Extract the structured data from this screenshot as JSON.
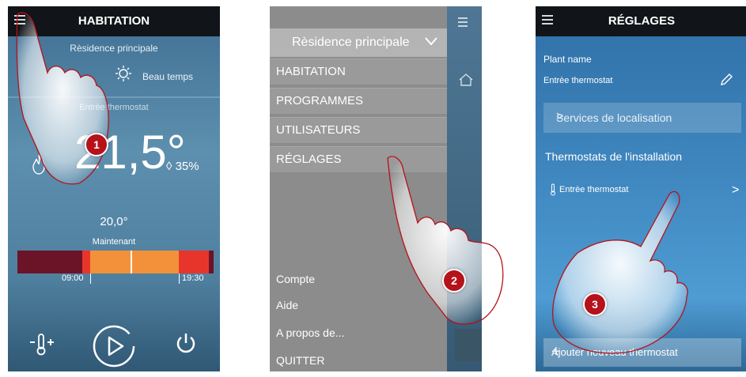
{
  "screen1": {
    "title": "HABITATION",
    "residence": "Rèsidence principale",
    "weather": "Beau temps",
    "thermostat_name": "Entrèe thermostat",
    "temperature": "21,5°",
    "humidity": "35%",
    "setpoint": "20,0°",
    "now_label": "Maintenant",
    "time_start": "09:00",
    "time_end": "19:30",
    "step_badge": "1"
  },
  "screen2": {
    "residence": "Rèsidence principale",
    "menu_items": [
      "HABITATION",
      "PROGRAMMES",
      "UTILISATEURS",
      "RÉGLAGES"
    ],
    "bottom_items": [
      "Compte",
      "Aide",
      "A propos de...",
      "QUITTER"
    ],
    "step_badge": "2"
  },
  "screen3": {
    "title": "RÉGLAGES",
    "plant_name_label": "Plant name",
    "plant_name_value": "Entrèe thermostat",
    "location_services": "Services de localisation",
    "thermostats_heading": "Thermostats de l'installation",
    "thermostat_item": "Entrèe thermostat",
    "add_thermostat": "Ajouter nouveau thermostat",
    "step_badge": "3"
  },
  "colors": {
    "topbar": "#111418",
    "badge": "#b5121b",
    "schedule_dark": "#6b1427",
    "schedule_orange": "#f2913a",
    "schedule_red": "#e8352c",
    "hand_outline": "#b5121b"
  }
}
